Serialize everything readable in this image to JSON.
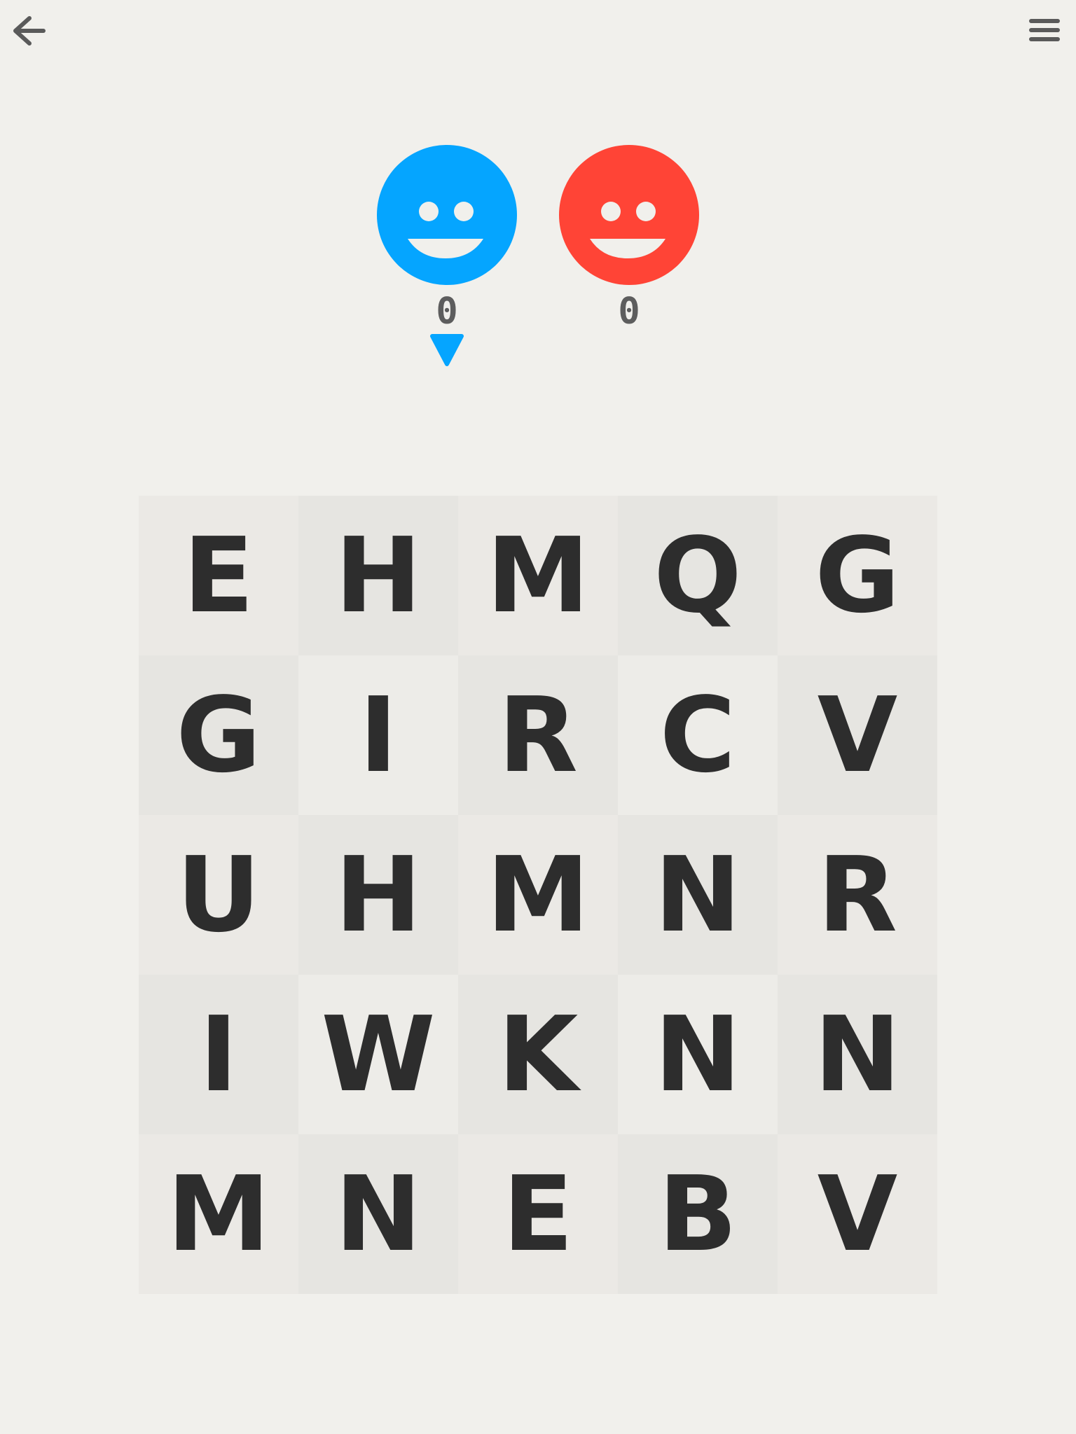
{
  "header": {
    "back_icon": "back-arrow-icon",
    "menu_icon": "hamburger-menu-icon"
  },
  "players": [
    {
      "color": "#05a5ff",
      "score": "0",
      "face_icon": "smiley-face-icon"
    },
    {
      "color": "#ff4436",
      "score": "0",
      "face_icon": "smiley-face-icon"
    }
  ],
  "turn": {
    "active_player": 0,
    "indicator_icon": "triangle-down-icon",
    "color": "#05a5ff"
  },
  "board": {
    "rows": [
      [
        "E",
        "H",
        "M",
        "Q",
        "G"
      ],
      [
        "G",
        "I",
        "R",
        "C",
        "V"
      ],
      [
        "U",
        "H",
        "M",
        "N",
        "R"
      ],
      [
        "I",
        "W",
        "K",
        "N",
        "N"
      ],
      [
        "M",
        "N",
        "E",
        "B",
        "V"
      ]
    ]
  },
  "colors": {
    "background": "#f1f0ec",
    "letter": "#2d2d2d",
    "score": "#5d5d5d",
    "icon": "#5a5a5a"
  }
}
